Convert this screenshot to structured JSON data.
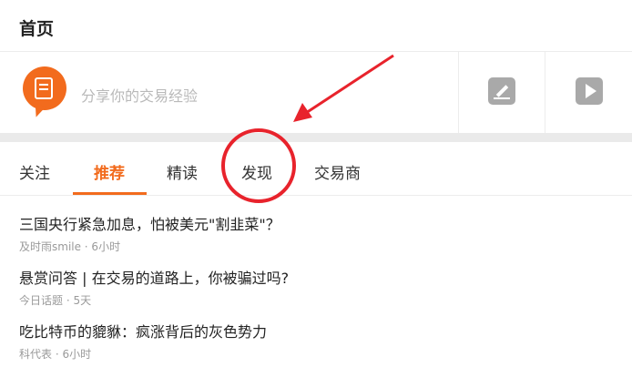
{
  "header": {
    "title": "首页"
  },
  "composer": {
    "placeholder": "分享你的交易经验"
  },
  "tabs": [
    {
      "label": "关注",
      "active": false
    },
    {
      "label": "推荐",
      "active": true
    },
    {
      "label": "精读",
      "active": false
    },
    {
      "label": "发现",
      "active": false
    },
    {
      "label": "交易商",
      "active": false
    }
  ],
  "feed": [
    {
      "title": "三国央行紧急加息，怕被美元\"割韭菜\"？",
      "meta": "及时雨smile · 6小时"
    },
    {
      "title": "悬赏问答 | 在交易的道路上，你被骗过吗?",
      "meta": "今日话题 · 5天"
    },
    {
      "title": "吃比特币的貔貅：疯涨背后的灰色势力",
      "meta": "科代表 · 6小时"
    }
  ],
  "colors": {
    "accent": "#f26b1d",
    "annotation": "#e8232c"
  },
  "icons": {
    "avatar": "note-bubble-icon",
    "edit": "edit-icon",
    "video": "play-icon"
  }
}
